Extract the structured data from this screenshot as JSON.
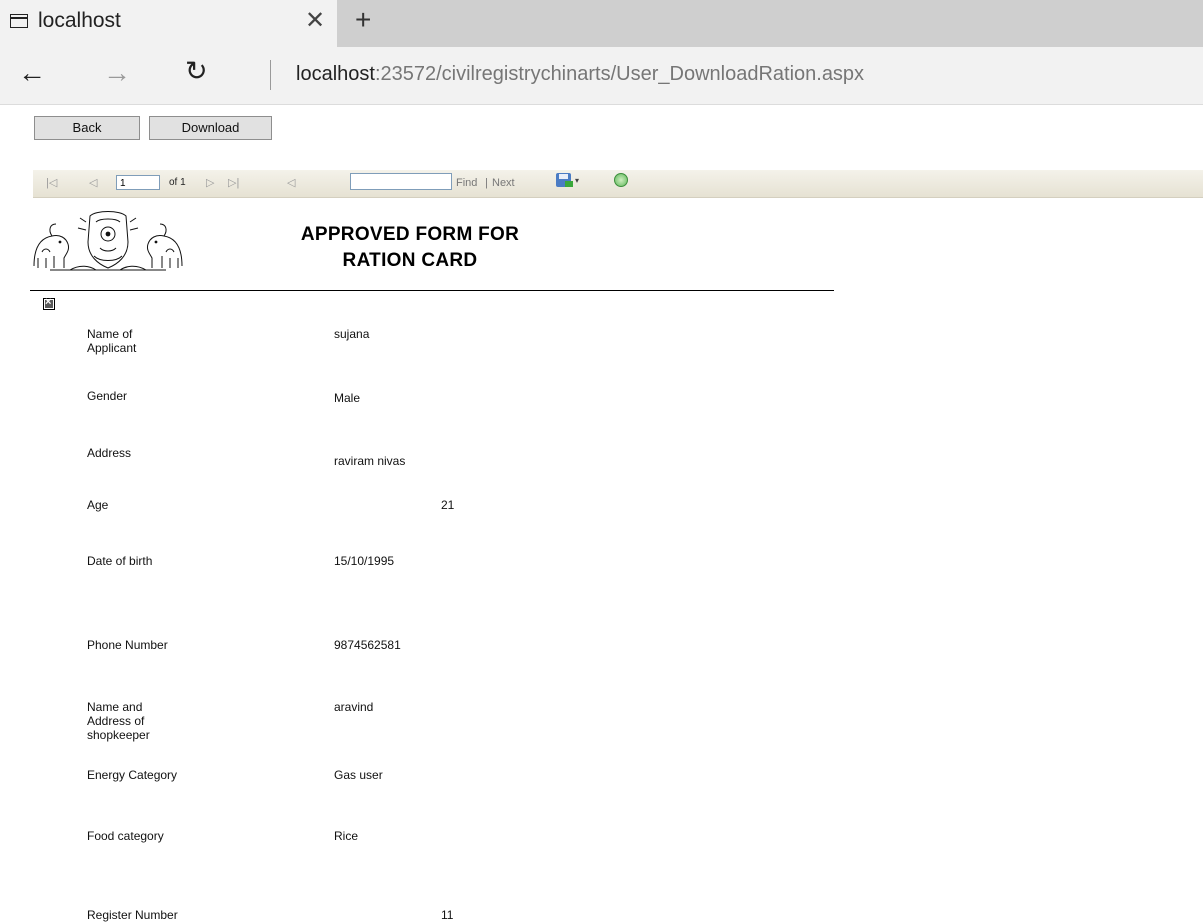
{
  "browser": {
    "tab_title": "localhost",
    "close_symbol": "✕",
    "new_tab_symbol": "+",
    "url_host": "localhost",
    "url_rest": ":23572/civilregistrychinarts/User_DownloadRation.aspx",
    "back_symbol": "←",
    "forward_symbol": "→",
    "refresh_symbol": "↻"
  },
  "page": {
    "back_button": "Back",
    "download_button": "Download"
  },
  "viewer": {
    "first_symbol": "|◁",
    "prev_symbol": "◁",
    "page_value": "1",
    "of_text": "of 1",
    "next_symbol": "▷",
    "last_symbol": "▷|",
    "back_nav_symbol": "◁",
    "find_label": "Find",
    "separator": "|",
    "next_label": "Next",
    "dropdown_symbol": "▾",
    "icons": [
      "first-page-icon",
      "prev-page-icon",
      "next-page-icon",
      "last-page-icon",
      "back-to-parent-icon",
      "save-export-icon",
      "refresh-icon"
    ]
  },
  "report": {
    "title_line1": "APPROVED FORM FOR",
    "title_line2": "RATION CARD",
    "fields": [
      {
        "label": "Name of\nApplicant",
        "value": "sujana"
      },
      {
        "label": "Gender",
        "value": "Male"
      },
      {
        "label": "Address",
        "value": "raviram nivas"
      },
      {
        "label": "Age",
        "value": "21"
      },
      {
        "label": "Date of birth",
        "value": "15/10/1995"
      },
      {
        "label": "Phone Number",
        "value": "9874562581"
      },
      {
        "label": "Name and\nAddress of\nshopkeeper",
        "value": "aravind"
      },
      {
        "label": "Energy Category",
        "value": "Gas user"
      },
      {
        "label": "Food category",
        "value": "Rice"
      },
      {
        "label": "Register Number",
        "value": "11"
      }
    ]
  }
}
